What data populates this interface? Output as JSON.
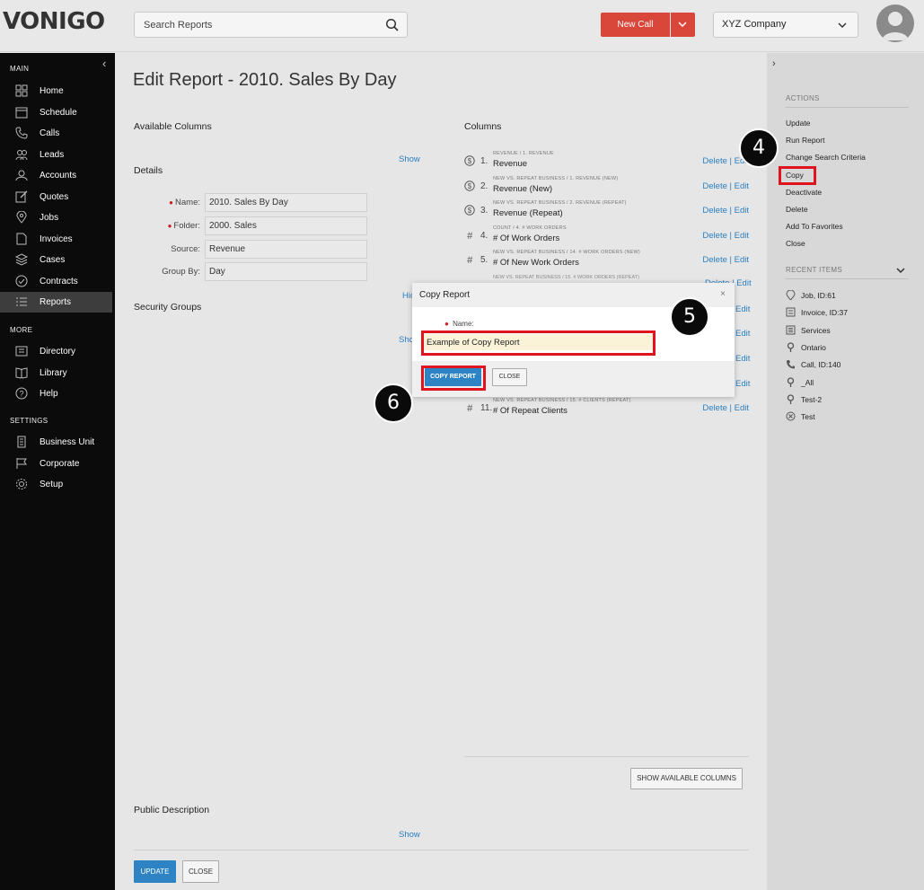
{
  "brand": "VONIGO",
  "search": {
    "placeholder": "Search Reports"
  },
  "header": {
    "new_call": "New Call",
    "company": "XYZ Company"
  },
  "sidebar": {
    "main_label": "MAIN",
    "more_label": "MORE",
    "settings_label": "SETTINGS",
    "main_items": [
      {
        "label": "Home",
        "icon": "home-icon"
      },
      {
        "label": "Schedule",
        "icon": "calendar-icon"
      },
      {
        "label": "Calls",
        "icon": "phone-icon"
      },
      {
        "label": "Leads",
        "icon": "users-icon"
      },
      {
        "label": "Accounts",
        "icon": "user-icon"
      },
      {
        "label": "Quotes",
        "icon": "edit-icon"
      },
      {
        "label": "Jobs",
        "icon": "map-pin-icon"
      },
      {
        "label": "Invoices",
        "icon": "document-icon"
      },
      {
        "label": "Cases",
        "icon": "layers-icon"
      },
      {
        "label": "Contracts",
        "icon": "check-circle-icon"
      },
      {
        "label": "Reports",
        "icon": "list-icon"
      }
    ],
    "more_items": [
      {
        "label": "Directory",
        "icon": "directory-icon"
      },
      {
        "label": "Library",
        "icon": "book-icon"
      },
      {
        "label": "Help",
        "icon": "help-icon"
      }
    ],
    "settings_items": [
      {
        "label": "Business Unit",
        "icon": "building-icon"
      },
      {
        "label": "Corporate",
        "icon": "flag-icon"
      },
      {
        "label": "Setup",
        "icon": "gear-icon"
      }
    ]
  },
  "page": {
    "title": "Edit Report - 2010. Sales By Day"
  },
  "available_columns": {
    "label": "Available Columns",
    "show": "Show"
  },
  "details": {
    "label": "Details",
    "name_label": "Name:",
    "name_value": "2010. Sales By Day",
    "folder_label": "Folder:",
    "folder_value": "2000. Sales",
    "source_label": "Source:",
    "source_value": "Revenue",
    "groupby_label": "Group By:",
    "groupby_value": "Day",
    "hide_partial": "Hic"
  },
  "security_groups": {
    "label": "Security Groups",
    "show_partial": "Sho"
  },
  "columns": {
    "label": "Columns",
    "delete": "Delete",
    "edit": "Edit",
    "rows": [
      {
        "num": "1.",
        "sub": "REVENUE / 1. REVENUE",
        "name": "Revenue",
        "icon": "dollar-icon"
      },
      {
        "num": "2.",
        "sub": "NEW VS. REPEAT BUSINESS / 1. REVENUE (NEW)",
        "name": "Revenue (New)",
        "icon": "dollar-icon"
      },
      {
        "num": "3.",
        "sub": "NEW VS. REPEAT BUSINESS / 2. REVENUE (REPEAT)",
        "name": "Revenue (Repeat)",
        "icon": "dollar-icon"
      },
      {
        "num": "4.",
        "sub": "COUNT / 4. # WORK ORDERS",
        "name": "# Of Work Orders",
        "icon": "hash-icon"
      },
      {
        "num": "5.",
        "sub": "NEW VS. REPEAT BUSINESS / 14. # WORK ORDERS (NEW)",
        "name": "# Of New Work Orders",
        "icon": "hash-icon"
      },
      {
        "num": "11.",
        "sub": "NEW VS. REPEAT BUSINESS / 15. # CLIENTS (REPEAT)",
        "name": "# Of Repeat Clients",
        "icon": "hash-icon"
      }
    ],
    "partial_sub_6": "NEW VS. REPEAT BUSINESS / 15. # WORK ORDERS (REPEAT)",
    "partial_action": "Delete | Edit",
    "partial_edit": "Edit",
    "show_available": "SHOW AVAILABLE COLUMNS"
  },
  "public_description": {
    "label": "Public Description",
    "show": "Show"
  },
  "footer": {
    "update": "UPDATE",
    "close": "CLOSE"
  },
  "actions": {
    "heading": "ACTIONS",
    "items": [
      "Update",
      "Run Report",
      "Change Search Criteria",
      "Copy",
      "Deactivate",
      "Delete",
      "Add To Favorites",
      "Close"
    ]
  },
  "recent": {
    "heading": "RECENT ITEMS",
    "items": [
      {
        "label": "Job, ID:61",
        "icon": "map-pin-icon"
      },
      {
        "label": "Invoice, ID:37",
        "icon": "invoice-icon"
      },
      {
        "label": "Services",
        "icon": "list-box-icon"
      },
      {
        "label": "Ontario",
        "icon": "location-icon"
      },
      {
        "label": "Call, ID:140",
        "icon": "phone-icon"
      },
      {
        "label": "_All",
        "icon": "location-icon"
      },
      {
        "label": "Test-2",
        "icon": "location-icon"
      },
      {
        "label": "Test",
        "icon": "close-circle-icon"
      }
    ]
  },
  "modal": {
    "title": "Copy Report",
    "close": "×",
    "name_label": "Name:",
    "name_value": "Example of Copy Report",
    "copy_button": "COPY REPORT",
    "close_button": "CLOSE"
  },
  "steps": [
    "4",
    "5",
    "6"
  ],
  "colors": {
    "accent": "#2d83c4",
    "new_call": "#d9463a",
    "highlight": "#e0141e",
    "sidebar": "#0b0b0b"
  }
}
